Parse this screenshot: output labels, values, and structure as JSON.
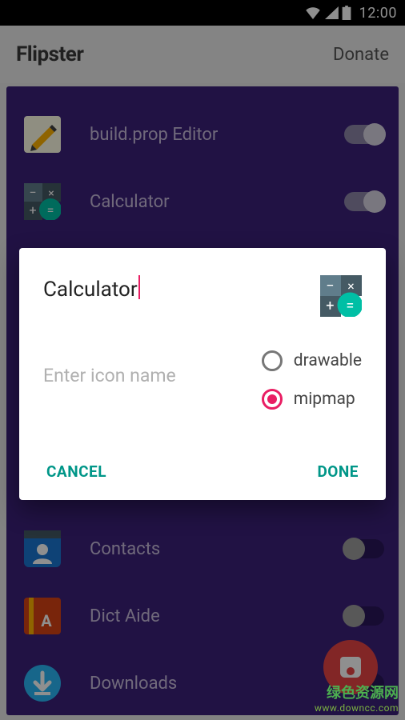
{
  "status": {
    "time": "12:00"
  },
  "header": {
    "title": "Flipster",
    "donate": "Donate"
  },
  "list": {
    "items": [
      {
        "label": "build.prop Editor",
        "on": true
      },
      {
        "label": "Calculator",
        "on": true
      },
      {
        "label": "Contacts",
        "on": false
      },
      {
        "label": "Dict Aide",
        "on": false
      },
      {
        "label": "Downloads",
        "on": false
      }
    ]
  },
  "dialog": {
    "name_value": "Calculator",
    "icon_name_placeholder": "Enter icon name",
    "radios": {
      "drawable": "drawable",
      "mipmap": "mipmap",
      "selected": "mipmap"
    },
    "cancel": "CANCEL",
    "done": "DONE"
  },
  "watermark": {
    "line1": "绿色资源网",
    "line2": "www.downcc.com"
  }
}
